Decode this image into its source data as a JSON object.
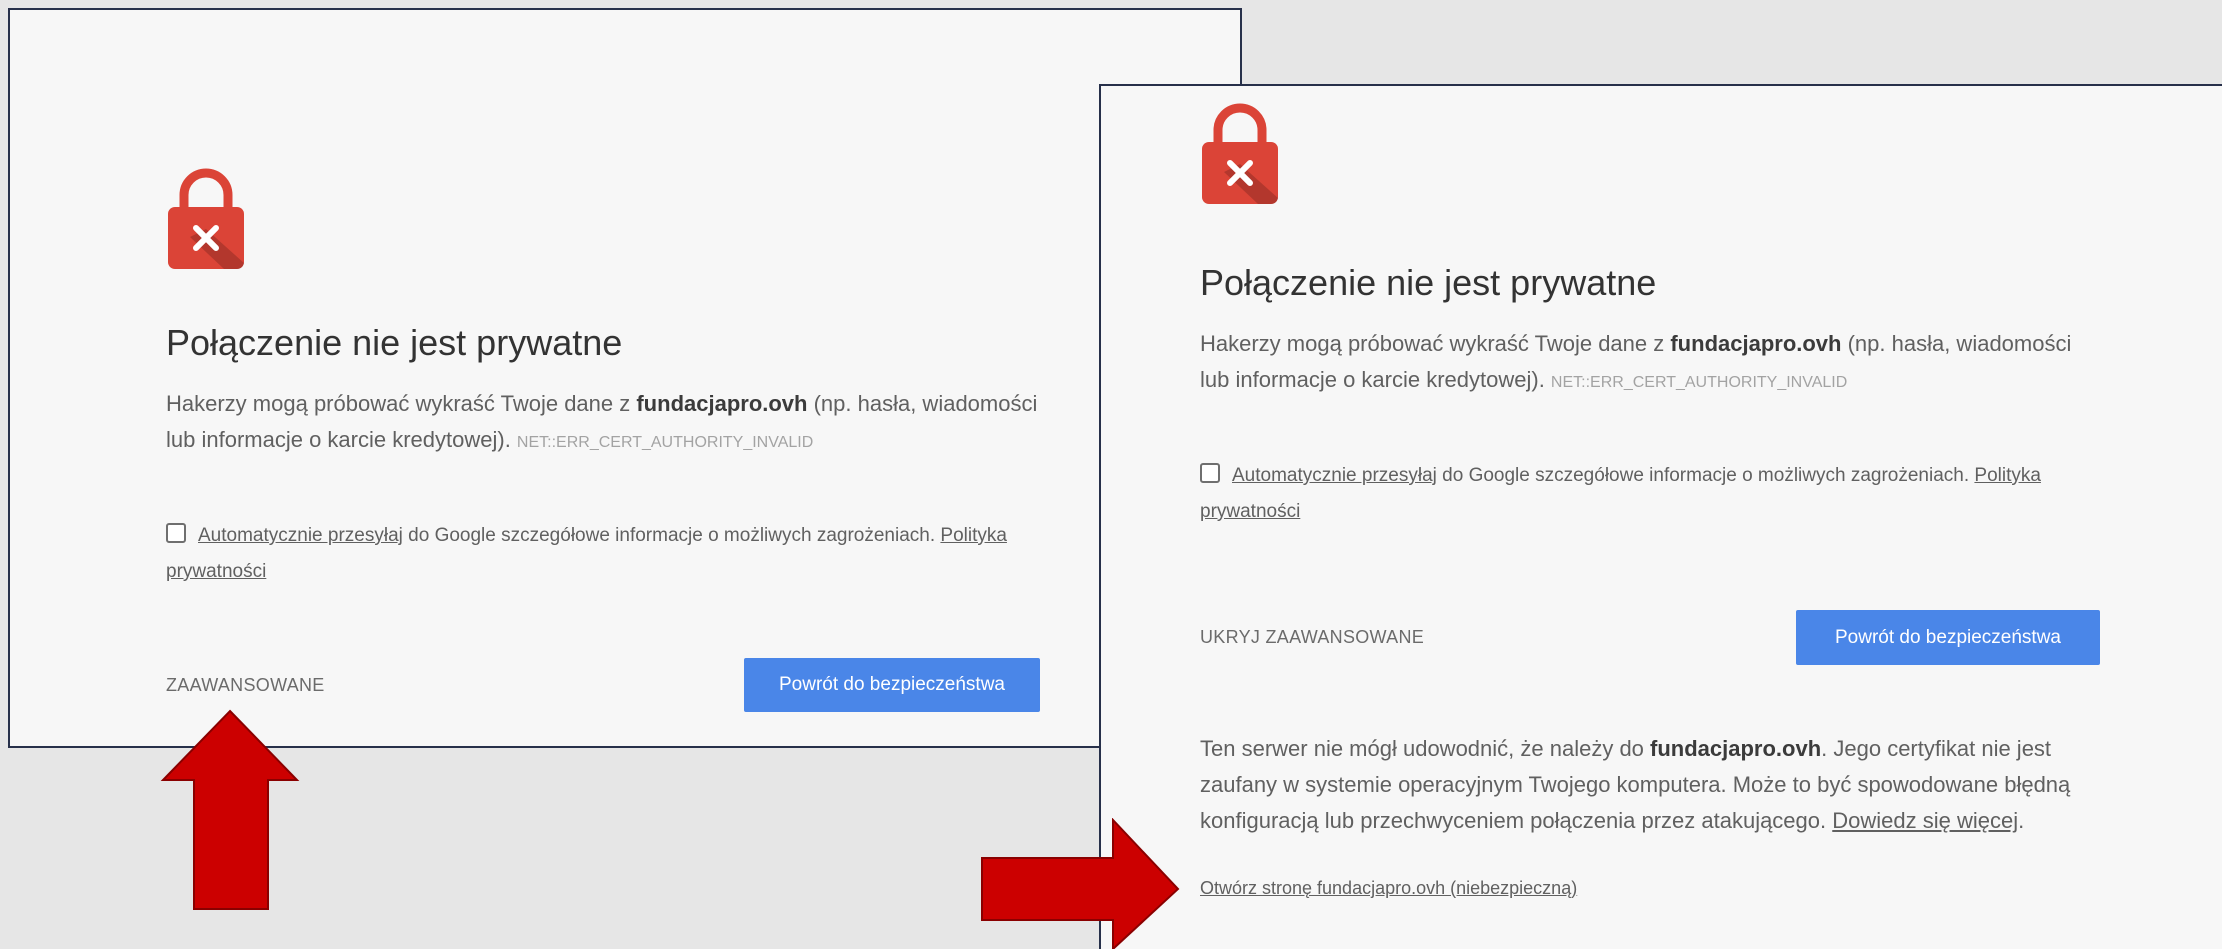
{
  "colors": {
    "lock_red": "#db4437",
    "button_blue": "#4a86e8",
    "arrow_red": "#cc0000",
    "frame_border": "#27304a"
  },
  "icons": {
    "lock": "lock-error-icon",
    "checkbox": "checkbox-icon"
  },
  "left": {
    "title": "Połączenie nie jest prywatne",
    "desc_prefix": "Hakerzy mogą próbować wykraść Twoje dane z ",
    "domain": "fundacjapro.ovh",
    "desc_suffix": " (np. hasła, wiadomości lub informacje o karcie kredytowej). ",
    "error_code": "NET::ERR_CERT_AUTHORITY_INVALID",
    "report_link": "Automatycznie przesyłaj",
    "report_text": " do Google szczegółowe informacje o możliwych zagrożeniach. ",
    "privacy_link": "Polityka prywatności",
    "advanced": "ZAAWANSOWANE",
    "back_button": "Powrót do bezpieczeństwa"
  },
  "right": {
    "title": "Połączenie nie jest prywatne",
    "desc_prefix": "Hakerzy mogą próbować wykraść Twoje dane z ",
    "domain": "fundacjapro.ovh",
    "desc_suffix": " (np. hasła, wiadomości lub informacje o karcie kredytowej). ",
    "error_code": "NET::ERR_CERT_AUTHORITY_INVALID",
    "report_link": "Automatycznie przesyłaj",
    "report_text": " do Google szczegółowe informacje o możliwych zagrożeniach. ",
    "privacy_link": "Polityka prywatności",
    "hide_advanced": "UKRYJ ZAAWANSOWANE",
    "back_button": "Powrót do bezpieczeństwa",
    "details_prefix": "Ten serwer nie mógł udowodnić, że należy do ",
    "details_domain": "fundacjapro.ovh",
    "details_suffix": ". Jego certyfikat nie jest zaufany w systemie operacyjnym Twojego komputera. Może to być spowodowane błędną konfiguracją lub przechwyceniem połączenia przez atakującego. ",
    "learn_more": "Dowiedz się więcej",
    "details_end": ".",
    "proceed_link": "Otwórz stronę fundacjapro.ovh (niebezpieczną)"
  }
}
